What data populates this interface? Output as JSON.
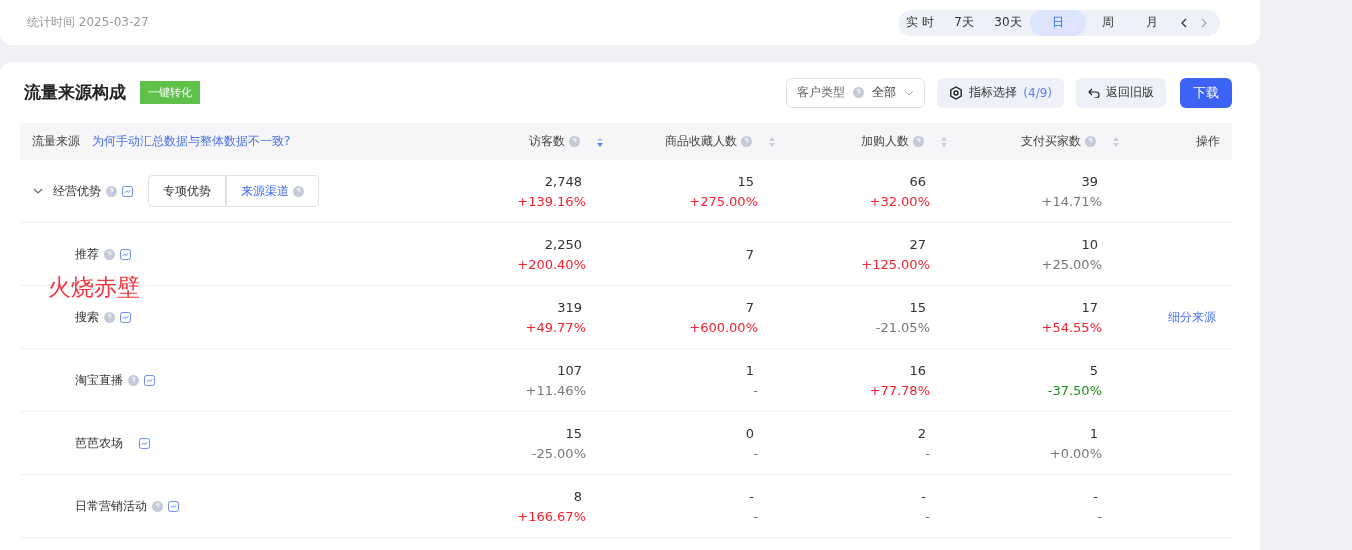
{
  "stat_time": "统计时间 2025-03-27",
  "period_tabs": [
    {
      "label": "实 时",
      "selected": false
    },
    {
      "label": "7天",
      "selected": false
    },
    {
      "label": "30天",
      "selected": false
    },
    {
      "label": "日",
      "selected": true
    },
    {
      "label": "周",
      "selected": false
    },
    {
      "label": "月",
      "selected": false
    }
  ],
  "card": {
    "title": "流量来源构成",
    "badge": "一键转化",
    "customer_filter": {
      "label": "客户类型",
      "value": "全部"
    },
    "metric_button": {
      "label": "指标选择",
      "count": "(4/9)"
    },
    "back_button": "返回旧版",
    "download_button": "下载"
  },
  "table": {
    "source_header": "流量来源",
    "help_link": "为何手动汇总数据与整体数据不一致?",
    "columns": [
      {
        "label": "访客数",
        "sorted": true
      },
      {
        "label": "商品收藏人数",
        "sorted": false
      },
      {
        "label": "加购人数",
        "sorted": false
      },
      {
        "label": "支付买家数",
        "sorted": false
      }
    ],
    "action_header": "操作",
    "rows": [
      {
        "name": "经营优势",
        "help": true,
        "expanded": true,
        "tabs": [
          {
            "label": "专项优势",
            "selected": false,
            "help": false
          },
          {
            "label": "来源渠道",
            "selected": true,
            "help": true
          }
        ],
        "cells": [
          {
            "value": "2,748",
            "change": "+139.16%",
            "color": "#f5222d"
          },
          {
            "value": "15",
            "change": "+275.00%",
            "color": "#f5222d"
          },
          {
            "value": "66",
            "change": "+32.00%",
            "color": "#f5222d"
          },
          {
            "value": "39",
            "change": "+14.71%",
            "color": "#777777"
          }
        ],
        "children": [
          {
            "name": "推荐",
            "help": true,
            "cells": [
              {
                "value": "2,250",
                "change": "+200.40%",
                "color": "#f5222d"
              },
              {
                "value": "7"
              },
              {
                "value": "27",
                "change": "+125.00%",
                "color": "#f5222d"
              },
              {
                "value": "10",
                "change": "+25.00%",
                "color": "#777777"
              }
            ]
          },
          {
            "name": "搜索",
            "help": true,
            "action": "细分来源",
            "cells": [
              {
                "value": "319",
                "change": "+49.77%",
                "color": "#f5222d"
              },
              {
                "value": "7",
                "change": "+600.00%",
                "color": "#f5222d"
              },
              {
                "value": "15",
                "change": "-21.05%",
                "color": "#777777"
              },
              {
                "value": "17",
                "change": "+54.55%",
                "color": "#f5222d"
              }
            ]
          },
          {
            "name": "淘宝直播",
            "help": true,
            "cells": [
              {
                "value": "107",
                "change": "+11.46%",
                "color": "#777777"
              },
              {
                "value": "1",
                "change": "-",
                "color": "#777777"
              },
              {
                "value": "16",
                "change": "+77.78%",
                "color": "#f5222d"
              },
              {
                "value": "5",
                "change": "-37.50%",
                "color": "#1d8f1d"
              }
            ]
          },
          {
            "name": "芭芭农场",
            "help": false,
            "cells": [
              {
                "value": "15",
                "change": "-25.00%",
                "color": "#777777"
              },
              {
                "value": "0",
                "change": "-",
                "color": "#777777"
              },
              {
                "value": "2",
                "change": "-",
                "color": "#777777"
              },
              {
                "value": "1",
                "change": "+0.00%",
                "color": "#777777"
              }
            ]
          },
          {
            "name": "日常营销活动",
            "help": true,
            "cells": [
              {
                "value": "8",
                "change": "+166.67%",
                "color": "#f5222d"
              },
              {
                "value": "-",
                "change": "-",
                "color": "#777777"
              },
              {
                "value": "-",
                "change": "-",
                "color": "#777777"
              },
              {
                "value": "-",
                "change": "-",
                "color": "#777777"
              }
            ]
          }
        ]
      }
    ]
  },
  "overlay_note": "火烧赤壁"
}
